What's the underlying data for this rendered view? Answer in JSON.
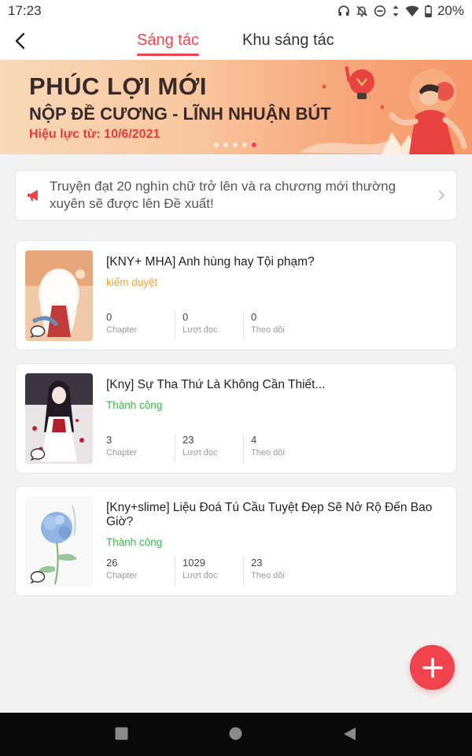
{
  "status_bar": {
    "time": "17:23",
    "battery": "20%",
    "icons": [
      "headphones-icon",
      "bell-off-icon",
      "dnd-icon",
      "data-arrows-icon",
      "wifi-icon",
      "battery-icon"
    ]
  },
  "header": {
    "back_icon": "back-arrow-icon",
    "tabs": [
      {
        "label": "Sáng tác",
        "active": true
      },
      {
        "label": "Khu sáng tác",
        "active": false
      }
    ],
    "accent": "#f0434e"
  },
  "banner": {
    "title": "PHÚC LỢI MỚI",
    "subtitle": "NỘP ĐỀ CƯƠNG - LĨNH NHUẬN BÚT",
    "date": "Hiệu lực từ: 10/6/2021",
    "slide_count": 5,
    "active_slide": 5
  },
  "notice": {
    "icon": "megaphone-icon",
    "text": "Truyện đạt 20 nghìn chữ trở lên và ra chương mới thường xuyên sẽ được lên Đề xuất!"
  },
  "stories": [
    {
      "title": "[KNY+ MHA] Anh hùng hay Tội phạm?",
      "status": "kiểm duyệt",
      "status_color": "#f0a43a",
      "chapter": "0",
      "views": "0",
      "follows": "0"
    },
    {
      "title": "[Kny] Sự Tha Thứ Là Không Cần Thiết...",
      "status": "Thành công",
      "status_color": "#3bb54a",
      "chapter": "3",
      "views": "23",
      "follows": "4"
    },
    {
      "title": "[Kny+slime] Liệu Đoá Tú Cầu Tuyệt Đẹp Sẽ Nở Rộ Đến Bao Giờ?",
      "status": "Thành công",
      "status_color": "#3bb54a",
      "chapter": "26",
      "views": "1029",
      "follows": "23"
    }
  ],
  "stat_labels": {
    "chapter": "Chapter",
    "views": "Lượt đọc",
    "follows": "Theo dõi"
  },
  "fab": {
    "icon": "plus-icon"
  },
  "nav": {
    "icons": [
      "recents-square-icon",
      "home-circle-icon",
      "back-triangle-icon"
    ]
  }
}
